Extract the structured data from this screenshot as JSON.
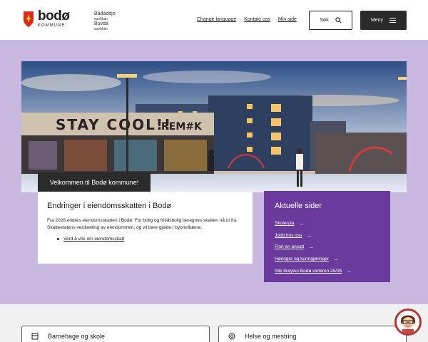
{
  "header": {
    "logo": {
      "name": "bodø",
      "sub": "KOMMUNE",
      "sami_lines": [
        "Bådåddjo",
        "suohkan",
        "Buvda",
        "suohkan"
      ]
    },
    "links": [
      "Change language",
      "Kontakt oss",
      "Min side"
    ],
    "search_label": "Søk",
    "menu_label": "Meny"
  },
  "hero": {
    "welcome": "Velkommen til Bodø kommune!"
  },
  "news": {
    "title": "Endringer i eiendomsskatten i Bodø",
    "body": "Fra 2026 endres eiendomsskatten i Bodø. For bolig og fritidsbolig beregnes skatten nå ut fra Skatteetatens verdsetting av eiendommen, og vil bare gjelde i byområdene.",
    "link": "Verd å vite om eiendomsskatt"
  },
  "pages": {
    "title": "Aktuelle sider",
    "items": [
      "Skoleruta",
      "Jobb hos oss",
      "Finn en ansatt",
      "Høringer og kunngjøringer",
      "Slik brøytes Bodø vinteren 25/26"
    ]
  },
  "tiles": [
    "Barnehage og skole",
    "Helse og mestring"
  ],
  "colors": {
    "band": "#c8b8e0",
    "accent": "#6a3a9c",
    "dark": "#2b2b2b",
    "avatar_ring": "#b2342d"
  }
}
